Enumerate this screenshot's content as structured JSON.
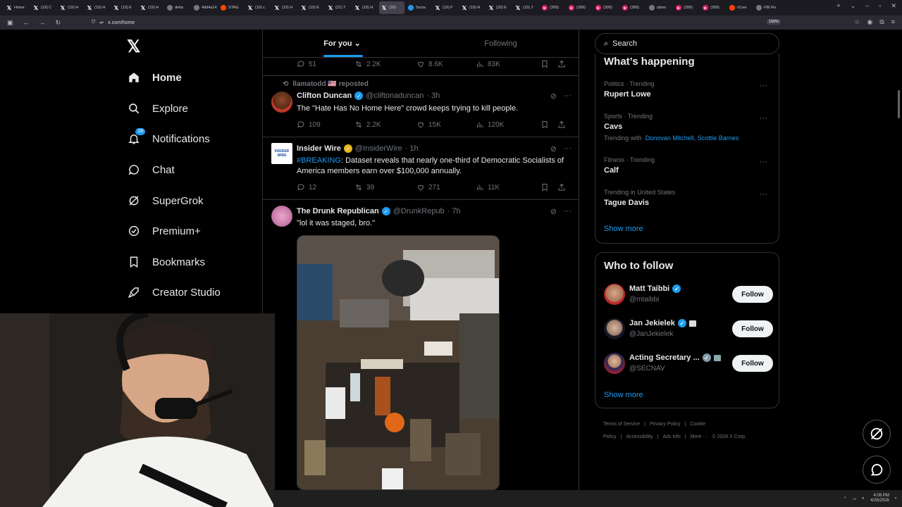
{
  "browser": {
    "tabs": [
      {
        "label": "Home",
        "icon": "x-icon"
      },
      {
        "label": "(19) C",
        "icon": "x-icon"
      },
      {
        "label": "(19) H",
        "icon": "x-icon"
      },
      {
        "label": "(19) H",
        "icon": "x-icon"
      },
      {
        "label": "(19) E",
        "icon": "x-icon"
      },
      {
        "label": "(19) H",
        "icon": "x-icon"
      },
      {
        "label": "delta",
        "icon": "globe-icon"
      },
      {
        "label": "4dd4a14",
        "icon": "page-icon"
      },
      {
        "label": "STAG",
        "icon": "reddit-icon"
      },
      {
        "label": "(19) c",
        "icon": "x-icon"
      },
      {
        "label": "(19) H",
        "icon": "x-icon"
      },
      {
        "label": "(19) E",
        "icon": "x-icon"
      },
      {
        "label": "(21) T",
        "icon": "x-icon"
      },
      {
        "label": "(18) H",
        "icon": "x-icon"
      },
      {
        "label": "(18)",
        "icon": "x-icon",
        "active": true
      },
      {
        "label": "Socia",
        "icon": "bluesky-icon"
      },
      {
        "label": "(19) F",
        "icon": "x-icon"
      },
      {
        "label": "(19) H",
        "icon": "x-icon"
      },
      {
        "label": "(20) E",
        "icon": "x-icon"
      },
      {
        "label": "(19) J",
        "icon": "x-icon"
      },
      {
        "label": "(399)",
        "icon": "youtube-icon"
      },
      {
        "label": "(399)",
        "icon": "youtube-icon"
      },
      {
        "label": "(399)",
        "icon": "youtube-icon"
      },
      {
        "label": "(399)",
        "icon": "youtube-icon"
      },
      {
        "label": "ubiso",
        "icon": "globe-icon"
      },
      {
        "label": "(399)",
        "icon": "youtube-icon"
      },
      {
        "label": "(399)",
        "icon": "youtube-icon"
      },
      {
        "label": "r/Live",
        "icon": "reddit-icon"
      },
      {
        "label": "FBI Ro",
        "icon": "page-icon"
      }
    ],
    "url": "x.com/home",
    "zoom": "150%"
  },
  "nav": {
    "items": [
      {
        "label": "Home",
        "icon": "home-icon"
      },
      {
        "label": "Explore",
        "icon": "search-icon"
      },
      {
        "label": "Notifications",
        "icon": "bell-icon",
        "badge": "18"
      },
      {
        "label": "Chat",
        "icon": "chat-icon"
      },
      {
        "label": "SuperGrok",
        "icon": "grok-icon"
      },
      {
        "label": "Premium+",
        "icon": "verified-badge-icon"
      },
      {
        "label": "Bookmarks",
        "icon": "bookmark-icon"
      },
      {
        "label": "Creator Studio",
        "icon": "rocket-icon"
      }
    ]
  },
  "main": {
    "tabs": [
      "For you",
      "Following"
    ],
    "top_actions": {
      "replies": "51",
      "reposts": "2.2K",
      "likes": "8.6K",
      "views": "83K"
    },
    "tweets": [
      {
        "repost_by": "llamatodd 🇺🇸 reposted",
        "name": "Clifton Duncan",
        "handle": "@cliftonaduncan",
        "time": "· 3h",
        "text": "The \"Hate Has No Home Here\" crowd keeps trying to kill people.",
        "replies": "109",
        "reposts": "2.2K",
        "likes": "15K",
        "views": "120K"
      },
      {
        "name": "Insider Wire",
        "handle": "@InsiderWire",
        "time": "· 1h",
        "hashtag": "#BREAKING",
        "text": ": Dataset reveals that nearly one-third of Democratic Socialists of America members earn over $100,000 annually.",
        "avatar_text": "INSIDER WIRE",
        "replies": "12",
        "reposts": "39",
        "likes": "271",
        "views": "11K"
      },
      {
        "name": "The Drunk Republican",
        "handle": "@DrunkRepub",
        "time": "· 7h",
        "text": "\"lol it was staged, bro.\""
      }
    ]
  },
  "right": {
    "search_placeholder": "Search",
    "happening_title": "What’s happening",
    "trends": [
      {
        "meta": "Politics · Trending",
        "name": "Rupert Lowe"
      },
      {
        "meta": "Sports · Trending",
        "name": "Cavs",
        "with_prefix": "Trending with",
        "with_links": "Donovan Mitchell, Scottie Barnes"
      },
      {
        "meta": "Fitness · Trending",
        "name": "Calf"
      },
      {
        "meta": "Trending in United States",
        "name": "Tague Davis"
      }
    ],
    "show_more": "Show more",
    "who_to_follow_title": "Who to follow",
    "follow_suggestions": [
      {
        "name": "Matt Taibbi",
        "handle": "@mtaibbi",
        "button": "Follow"
      },
      {
        "name": "Jan Jekielek",
        "handle": "@JanJekielek",
        "button": "Follow"
      },
      {
        "name": "Acting Secretary ...",
        "handle": "@SECNAV",
        "button": "Follow"
      }
    ],
    "footer_links": [
      "Terms of Service",
      "|",
      "Privacy Policy",
      "|",
      "Cookie Policy",
      "|",
      "Accessibility",
      "|",
      "Ads info",
      "|",
      "More ···",
      "© 2026 X Corp."
    ]
  },
  "taskbar": {
    "time": "4:09 PM",
    "date": "4/26/2026"
  },
  "colors": {
    "accent": "#1d9bf0",
    "background": "#000000",
    "border": "#2f3336",
    "muted": "#71767b"
  }
}
